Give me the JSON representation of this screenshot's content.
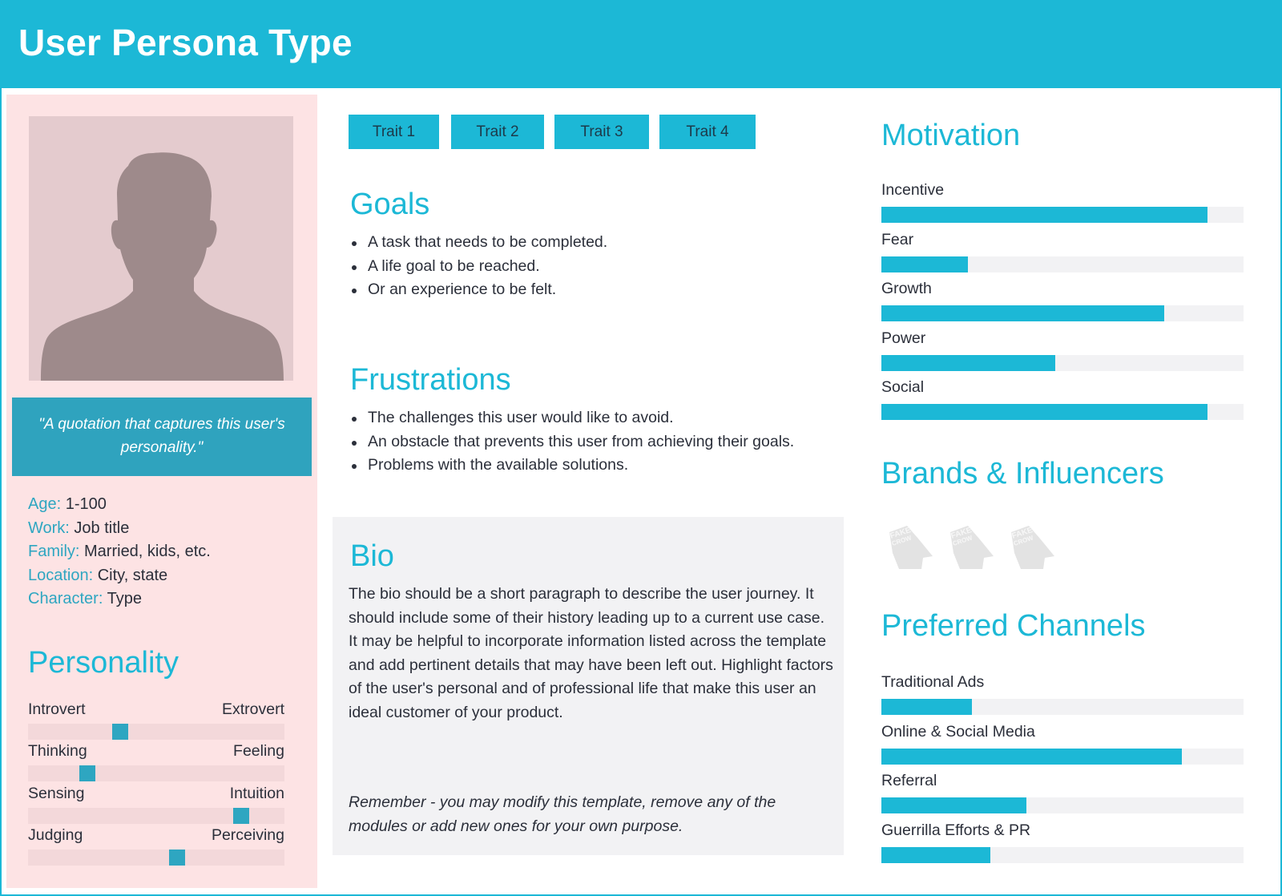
{
  "header": {
    "title": "User Persona Type"
  },
  "profile": {
    "photo_alt": "person-silhouette",
    "quote": "\"A quotation that captures this user's personality.\"",
    "facts": [
      {
        "key": "Age:",
        "value": "1-100"
      },
      {
        "key": "Work:",
        "value": "Job title"
      },
      {
        "key": "Family:",
        "value": "Married, kids, etc."
      },
      {
        "key": "Location:",
        "value": "City, state"
      },
      {
        "key": "Character:",
        "value": "Type"
      }
    ]
  },
  "personality": {
    "title": "Personality",
    "scales": [
      {
        "left": "Introvert",
        "right": "Extrovert",
        "position": 0.36
      },
      {
        "left": "Thinking",
        "right": "Feeling",
        "position": 0.23
      },
      {
        "left": "Sensing",
        "right": "Intuition",
        "position": 0.83
      },
      {
        "left": "Judging",
        "right": "Perceiving",
        "position": 0.58
      }
    ]
  },
  "traits": [
    "Trait 1",
    "Trait 2",
    "Trait 3",
    "Trait 4"
  ],
  "goals": {
    "title": "Goals",
    "items": [
      "A task that needs to be completed.",
      "A life goal to be reached.",
      "Or an experience to be felt."
    ]
  },
  "frustrations": {
    "title": "Frustrations",
    "items": [
      "The challenges this user would like to avoid.",
      "An obstacle that prevents this user from achieving their goals.",
      "Problems with the available solutions."
    ]
  },
  "bio": {
    "title": "Bio",
    "body": "The bio should be a short paragraph to describe the user journey. It should include some of their history leading up to a current use case. It may be helpful to incorporate information listed across the template and add pertinent details that may have been left out. Highlight factors of the user's personal and of professional life that make this user an ideal customer of your product.",
    "note": "Remember - you may modify this template, remove any of the modules or add new ones for your own purpose."
  },
  "motivation": {
    "title": "Motivation",
    "items": [
      {
        "label": "Incentive",
        "value": 0.9
      },
      {
        "label": "Fear",
        "value": 0.24
      },
      {
        "label": "Growth",
        "value": 0.78
      },
      {
        "label": "Power",
        "value": 0.48
      },
      {
        "label": "Social",
        "value": 0.9
      }
    ]
  },
  "brands": {
    "title": "Brands & Influencers",
    "logos": [
      "fake-crow-logo",
      "fake-crow-logo",
      "fake-crow-logo"
    ],
    "logo_text": [
      "FAKE",
      "CROW"
    ]
  },
  "channels": {
    "title": "Preferred Channels",
    "items": [
      {
        "label": "Traditional Ads",
        "value": 0.25
      },
      {
        "label": "Online & Social Media",
        "value": 0.83
      },
      {
        "label": "Referral",
        "value": 0.4
      },
      {
        "label": "Guerrilla Efforts & PR",
        "value": 0.3
      }
    ]
  },
  "colors": {
    "accent": "#1cb8d6",
    "accent_dark": "#2ea6c1",
    "profile_bg": "#fde3e4",
    "bio_bg": "#f2f2f4",
    "text": "#2b2f3a"
  }
}
